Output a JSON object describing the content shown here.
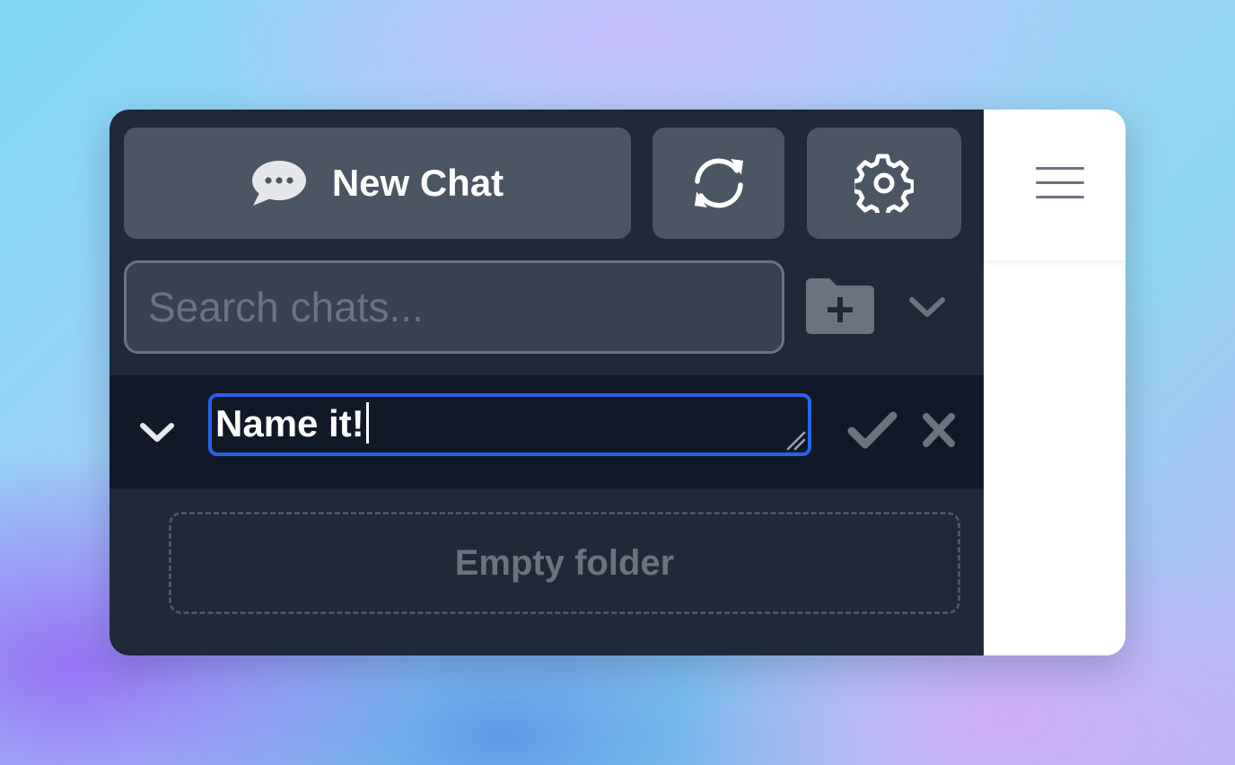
{
  "toolbar": {
    "new_chat_label": "New Chat",
    "new_chat_icon": "chat-bubble-dots-icon",
    "sync_icon": "sync-icon",
    "settings_icon": "gear-icon"
  },
  "search": {
    "placeholder": "Search chats...",
    "value": ""
  },
  "folder_actions": {
    "add_folder_icon": "folder-plus-icon",
    "collapse_icon": "chevron-down-icon"
  },
  "folder": {
    "rename_value": "Name it!",
    "expanded": true,
    "confirm_icon": "check-icon",
    "cancel_icon": "close-icon",
    "empty_text": "Empty folder"
  },
  "main": {
    "menu_icon": "hamburger-menu-icon"
  },
  "colors": {
    "sidebar_bg": "#1f2937",
    "button_bg": "#4b5563",
    "folder_row_bg": "#111827",
    "focus_accent": "#2563eb",
    "muted_text": "#6b7280"
  }
}
